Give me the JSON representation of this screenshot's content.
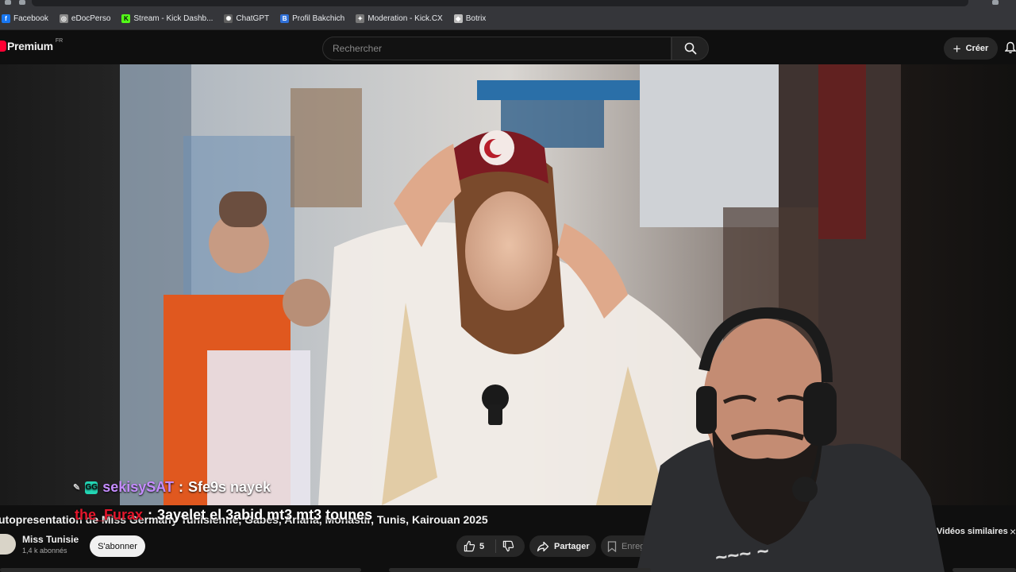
{
  "bookmarks": [
    {
      "label": "Facebook",
      "icon": "facebook-icon",
      "color": "#1877f2",
      "glyph": "f"
    },
    {
      "label": "eDocPerso",
      "icon": "globe-icon",
      "color": "#8a8a8a",
      "glyph": "◎"
    },
    {
      "label": "Stream - Kick Dashb...",
      "icon": "kick-icon",
      "color": "#53fc18",
      "glyph": "K"
    },
    {
      "label": "ChatGPT",
      "icon": "chatgpt-icon",
      "color": "#5f5f5f",
      "glyph": "✺"
    },
    {
      "label": "Profil Bakchich",
      "icon": "bakchich-icon",
      "color": "#2f6fd6",
      "glyph": "B"
    },
    {
      "label": "Moderation - Kick.CX",
      "icon": "moderation-icon",
      "color": "#777777",
      "glyph": "✦"
    },
    {
      "label": "Botrix",
      "icon": "botrix-icon",
      "color": "#bbbbbb",
      "glyph": "◆"
    }
  ],
  "header": {
    "logo_text": "Premium",
    "region": "FR",
    "search_placeholder": "Rechercher",
    "create_label": "Créer"
  },
  "chat": [
    {
      "user": "sekisySAT",
      "sep": ":",
      "message": "Sfe9s nayek"
    },
    {
      "user": "the_Furax",
      "sep": ":",
      "message": "3ayelet el 3abid mt3 mt3 tounes"
    }
  ],
  "video": {
    "title": "utopresentation de Miss Germany Tunisienne, Gabès, Ariana, Monastir, Tunis, Kairouan 2025",
    "channel_name": "Miss Tunisie",
    "subscribers": "1,4 k abonnés",
    "subscribe_label": "S'abonner",
    "likes": "5",
    "share_label": "Partager",
    "save_label": "Enreg",
    "similar_label": "Vidéos similaires",
    "close_label": "×"
  },
  "colors": {
    "accent_red": "#ff0033",
    "chat_user1": "#c58cff",
    "chat_user2": "#e4162c",
    "kick_green": "#53fc18"
  }
}
